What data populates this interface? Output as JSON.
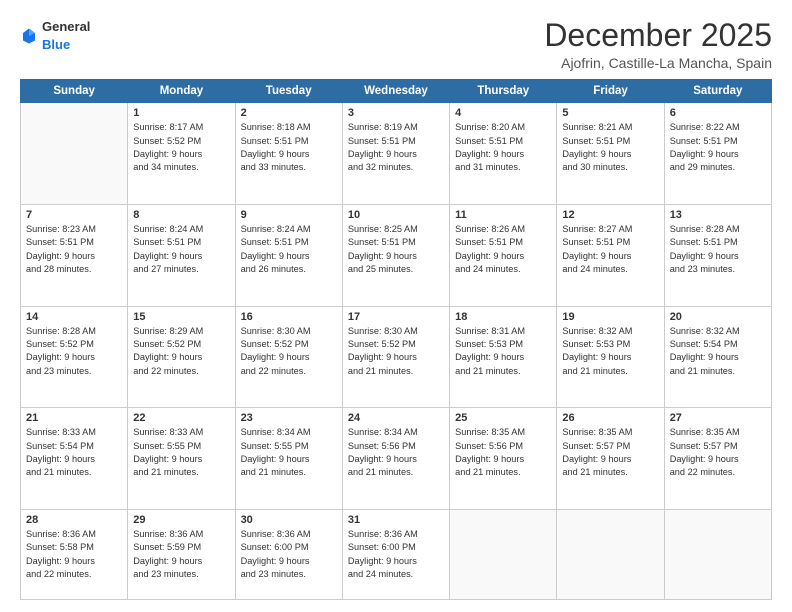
{
  "header": {
    "logo": {
      "general": "General",
      "blue": "Blue"
    },
    "title": "December 2025",
    "location": "Ajofrin, Castille-La Mancha, Spain"
  },
  "calendar": {
    "days_of_week": [
      "Sunday",
      "Monday",
      "Tuesday",
      "Wednesday",
      "Thursday",
      "Friday",
      "Saturday"
    ],
    "weeks": [
      [
        {
          "day": "",
          "content": ""
        },
        {
          "day": "1",
          "content": "Sunrise: 8:17 AM\nSunset: 5:52 PM\nDaylight: 9 hours\nand 34 minutes."
        },
        {
          "day": "2",
          "content": "Sunrise: 8:18 AM\nSunset: 5:51 PM\nDaylight: 9 hours\nand 33 minutes."
        },
        {
          "day": "3",
          "content": "Sunrise: 8:19 AM\nSunset: 5:51 PM\nDaylight: 9 hours\nand 32 minutes."
        },
        {
          "day": "4",
          "content": "Sunrise: 8:20 AM\nSunset: 5:51 PM\nDaylight: 9 hours\nand 31 minutes."
        },
        {
          "day": "5",
          "content": "Sunrise: 8:21 AM\nSunset: 5:51 PM\nDaylight: 9 hours\nand 30 minutes."
        },
        {
          "day": "6",
          "content": "Sunrise: 8:22 AM\nSunset: 5:51 PM\nDaylight: 9 hours\nand 29 minutes."
        }
      ],
      [
        {
          "day": "7",
          "content": "Sunrise: 8:23 AM\nSunset: 5:51 PM\nDaylight: 9 hours\nand 28 minutes."
        },
        {
          "day": "8",
          "content": "Sunrise: 8:24 AM\nSunset: 5:51 PM\nDaylight: 9 hours\nand 27 minutes."
        },
        {
          "day": "9",
          "content": "Sunrise: 8:24 AM\nSunset: 5:51 PM\nDaylight: 9 hours\nand 26 minutes."
        },
        {
          "day": "10",
          "content": "Sunrise: 8:25 AM\nSunset: 5:51 PM\nDaylight: 9 hours\nand 25 minutes."
        },
        {
          "day": "11",
          "content": "Sunrise: 8:26 AM\nSunset: 5:51 PM\nDaylight: 9 hours\nand 24 minutes."
        },
        {
          "day": "12",
          "content": "Sunrise: 8:27 AM\nSunset: 5:51 PM\nDaylight: 9 hours\nand 24 minutes."
        },
        {
          "day": "13",
          "content": "Sunrise: 8:28 AM\nSunset: 5:51 PM\nDaylight: 9 hours\nand 23 minutes."
        }
      ],
      [
        {
          "day": "14",
          "content": "Sunrise: 8:28 AM\nSunset: 5:52 PM\nDaylight: 9 hours\nand 23 minutes."
        },
        {
          "day": "15",
          "content": "Sunrise: 8:29 AM\nSunset: 5:52 PM\nDaylight: 9 hours\nand 22 minutes."
        },
        {
          "day": "16",
          "content": "Sunrise: 8:30 AM\nSunset: 5:52 PM\nDaylight: 9 hours\nand 22 minutes."
        },
        {
          "day": "17",
          "content": "Sunrise: 8:30 AM\nSunset: 5:52 PM\nDaylight: 9 hours\nand 21 minutes."
        },
        {
          "day": "18",
          "content": "Sunrise: 8:31 AM\nSunset: 5:53 PM\nDaylight: 9 hours\nand 21 minutes."
        },
        {
          "day": "19",
          "content": "Sunrise: 8:32 AM\nSunset: 5:53 PM\nDaylight: 9 hours\nand 21 minutes."
        },
        {
          "day": "20",
          "content": "Sunrise: 8:32 AM\nSunset: 5:54 PM\nDaylight: 9 hours\nand 21 minutes."
        }
      ],
      [
        {
          "day": "21",
          "content": "Sunrise: 8:33 AM\nSunset: 5:54 PM\nDaylight: 9 hours\nand 21 minutes."
        },
        {
          "day": "22",
          "content": "Sunrise: 8:33 AM\nSunset: 5:55 PM\nDaylight: 9 hours\nand 21 minutes."
        },
        {
          "day": "23",
          "content": "Sunrise: 8:34 AM\nSunset: 5:55 PM\nDaylight: 9 hours\nand 21 minutes."
        },
        {
          "day": "24",
          "content": "Sunrise: 8:34 AM\nSunset: 5:56 PM\nDaylight: 9 hours\nand 21 minutes."
        },
        {
          "day": "25",
          "content": "Sunrise: 8:35 AM\nSunset: 5:56 PM\nDaylight: 9 hours\nand 21 minutes."
        },
        {
          "day": "26",
          "content": "Sunrise: 8:35 AM\nSunset: 5:57 PM\nDaylight: 9 hours\nand 21 minutes."
        },
        {
          "day": "27",
          "content": "Sunrise: 8:35 AM\nSunset: 5:57 PM\nDaylight: 9 hours\nand 22 minutes."
        }
      ],
      [
        {
          "day": "28",
          "content": "Sunrise: 8:36 AM\nSunset: 5:58 PM\nDaylight: 9 hours\nand 22 minutes."
        },
        {
          "day": "29",
          "content": "Sunrise: 8:36 AM\nSunset: 5:59 PM\nDaylight: 9 hours\nand 23 minutes."
        },
        {
          "day": "30",
          "content": "Sunrise: 8:36 AM\nSunset: 6:00 PM\nDaylight: 9 hours\nand 23 minutes."
        },
        {
          "day": "31",
          "content": "Sunrise: 8:36 AM\nSunset: 6:00 PM\nDaylight: 9 hours\nand 24 minutes."
        },
        {
          "day": "",
          "content": ""
        },
        {
          "day": "",
          "content": ""
        },
        {
          "day": "",
          "content": ""
        }
      ]
    ]
  }
}
